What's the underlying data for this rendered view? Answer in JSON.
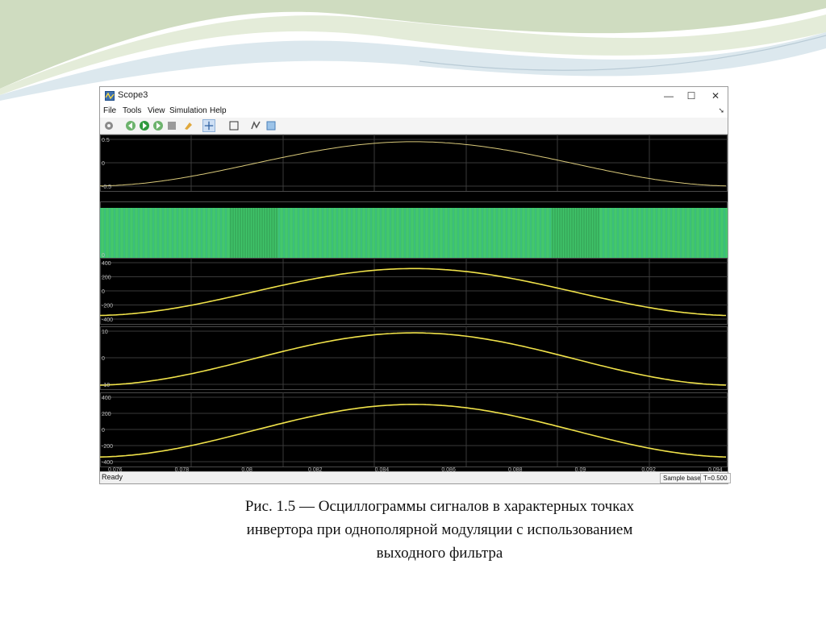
{
  "window": {
    "title": "Scope3",
    "controls": {
      "minimize": "—",
      "maximize": "☐",
      "close": "✕"
    }
  },
  "menu": {
    "items": [
      "File",
      "Tools",
      "View",
      "Simulation",
      "Help"
    ]
  },
  "toolbar": {
    "icons": [
      "gear-icon",
      "run-icon",
      "step-forward-icon",
      "stop-icon",
      "highlight-icon",
      "zoom-icon",
      "fit-axes-icon",
      "triggers-icon",
      "style-icon"
    ]
  },
  "scope": {
    "x_ticks": [
      "0.076",
      "0.078",
      "0.08",
      "0.082",
      "0.084",
      "0.086",
      "0.088",
      "0.09",
      "0.092",
      "0.094"
    ],
    "panels": [
      {
        "ticks": [
          "0.5",
          "0",
          "-0.5"
        ],
        "range": [
          -0.7,
          0.7
        ],
        "amplitude": 0.55,
        "color": "#d9c97a"
      },
      {
        "ticks": [
          "0"
        ],
        "fill": "green-band"
      },
      {
        "ticks": [
          "400",
          "200",
          "0",
          "-200",
          "-400"
        ],
        "range": [
          -450,
          450
        ],
        "amplitude": 320,
        "color": "#f0e24a"
      },
      {
        "ticks": [
          "10",
          "0",
          "-10"
        ],
        "range": [
          -12,
          12
        ],
        "amplitude": 10,
        "color": "#f0e24a"
      },
      {
        "ticks": [
          "400",
          "200",
          "0",
          "-200",
          "-400"
        ],
        "range": [
          -450,
          450
        ],
        "amplitude": 320,
        "color": "#f0e24a"
      }
    ]
  },
  "status": {
    "ready": "Ready",
    "sample_mode": "Sample based",
    "time": "T=0.500"
  },
  "caption": {
    "line1": "Рис. 1.5 — Осциллограммы сигналов в характерных точках",
    "line2": "инвертора при однополярной модуляции с использованием",
    "line3": "выходного фильтра"
  },
  "colors": {
    "trace": "#f0e24a",
    "band": "#3fc46a",
    "deco_green": "#c9d9b3",
    "deco_blue": "#d6e4ea"
  }
}
